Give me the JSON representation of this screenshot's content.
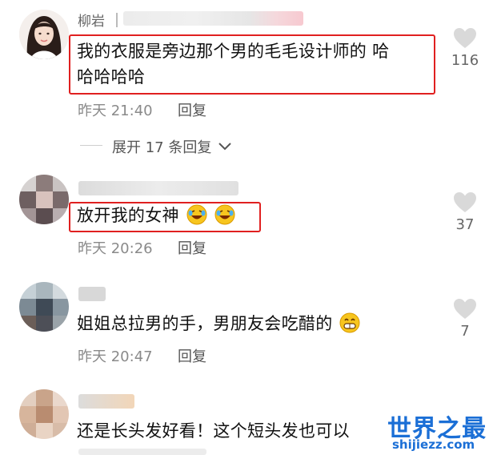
{
  "comments": [
    {
      "username": "柳岩",
      "text_line1": "我的衣服是旁边那个男的毛毛设计师的 哈",
      "text_line2": "哈哈哈哈",
      "time": "昨天 21:40",
      "reply_label": "回复",
      "likes": "116",
      "expand_label": "展开 17 条回复"
    },
    {
      "text": "放开我的女神",
      "emoji": [
        "rofl-emoji",
        "rofl-emoji"
      ],
      "time": "昨天 20:26",
      "reply_label": "回复",
      "likes": "37"
    },
    {
      "text": "姐姐总拉男的手，男朋友会吃醋的",
      "emoji": [
        "grin-emoji"
      ],
      "time": "昨天 20:47",
      "reply_label": "回复",
      "likes": "7"
    },
    {
      "text": "还是长头发好看！这个短头发也可以"
    }
  ],
  "watermark": {
    "brand": "世界之最",
    "domain": "shijiezz.com"
  },
  "colors": {
    "highlight": "#e02020",
    "watermark": "#1b6fd6",
    "meta_text": "#8a8a8a"
  }
}
